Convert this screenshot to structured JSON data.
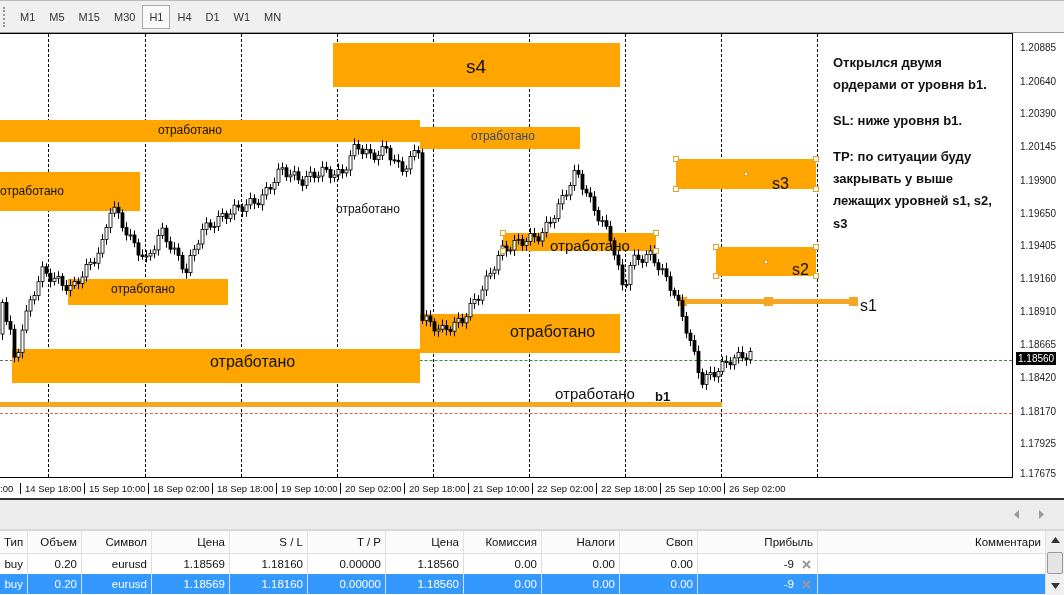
{
  "timeframes": [
    {
      "label": "M1",
      "selected": false
    },
    {
      "label": "M5",
      "selected": false
    },
    {
      "label": "M15",
      "selected": false
    },
    {
      "label": "M30",
      "selected": false
    },
    {
      "label": "H1",
      "selected": true
    },
    {
      "label": "H4",
      "selected": false
    },
    {
      "label": "D1",
      "selected": false
    },
    {
      "label": "W1",
      "selected": false
    },
    {
      "label": "MN",
      "selected": false
    }
  ],
  "chart": {
    "objects": [
      {
        "kind": "zone",
        "label": "s4",
        "selected": false
      },
      {
        "kind": "zone",
        "label": "отработано",
        "selected": false
      },
      {
        "kind": "zone",
        "label": "отработано",
        "selected": false
      },
      {
        "kind": "zone",
        "label": "отработано",
        "selected": false
      },
      {
        "kind": "text",
        "label": "отработано"
      },
      {
        "kind": "zone",
        "label": "s3",
        "selected": true
      },
      {
        "kind": "zone",
        "label": "отработано",
        "selected": false
      },
      {
        "kind": "zone",
        "label": "отработано",
        "selected": true
      },
      {
        "kind": "zone",
        "label": "s2",
        "selected": true
      },
      {
        "kind": "line",
        "label": "s1",
        "selected": true
      },
      {
        "kind": "zone",
        "label": "отработано",
        "selected": false
      },
      {
        "kind": "zone",
        "label": "отработано",
        "selected": false
      },
      {
        "kind": "line"
      },
      {
        "kind": "text",
        "label": "отработано"
      },
      {
        "kind": "tag",
        "label": "b1"
      }
    ],
    "note": [
      "Открылся двумя ордерами от уровня b1.",
      "SL: ниже уровня b1.",
      "TP: по ситуации буду закрывать у выше лежащих уровней s1, s2, s3"
    ],
    "price_axis": [
      {
        "label": "1.20885"
      },
      {
        "label": "1.20640"
      },
      {
        "label": "1.20390"
      },
      {
        "label": "1.20145"
      },
      {
        "label": "1.19900"
      },
      {
        "label": "1.19650"
      },
      {
        "label": "1.19405"
      },
      {
        "label": "1.19160"
      },
      {
        "label": "1.18910"
      },
      {
        "label": "1.18665"
      },
      {
        "label": "1.18560",
        "kind": "current"
      },
      {
        "label": "1.18420"
      },
      {
        "label": "1.18170"
      },
      {
        "label": "1.17925"
      },
      {
        "label": "1.17675"
      }
    ],
    "time_axis": [
      ":00",
      "14 Sep 18:00",
      "15 Sep 10:00",
      "18 Sep 02:00",
      "18 Sep 18:00",
      "19 Sep 10:00",
      "20 Sep 02:00",
      "20 Sep 18:00",
      "21 Sep 10:00",
      "22 Sep 02:00",
      "22 Sep 18:00",
      "25 Sep 10:00",
      "26 Sep 02:00"
    ]
  },
  "table": {
    "columns": [
      "Тип",
      "Объем",
      "Символ",
      "Цена",
      "S / L",
      "T / P",
      "Цена",
      "Комиссия",
      "Налоги",
      "Своп",
      "Прибыль",
      "Комментари"
    ],
    "rows": [
      {
        "cells": [
          "buy",
          "0.20",
          "eurusd",
          "1.18569",
          "1.18160",
          "0.00000",
          "1.18560",
          "0.00",
          "0.00",
          "0.00",
          "-9"
        ],
        "selected": false
      },
      {
        "cells": [
          "buy",
          "0.20",
          "eurusd",
          "1.18569",
          "1.18160",
          "0.00000",
          "1.18560",
          "0.00",
          "0.00",
          "0.00",
          "-9"
        ],
        "selected": true
      }
    ]
  }
}
